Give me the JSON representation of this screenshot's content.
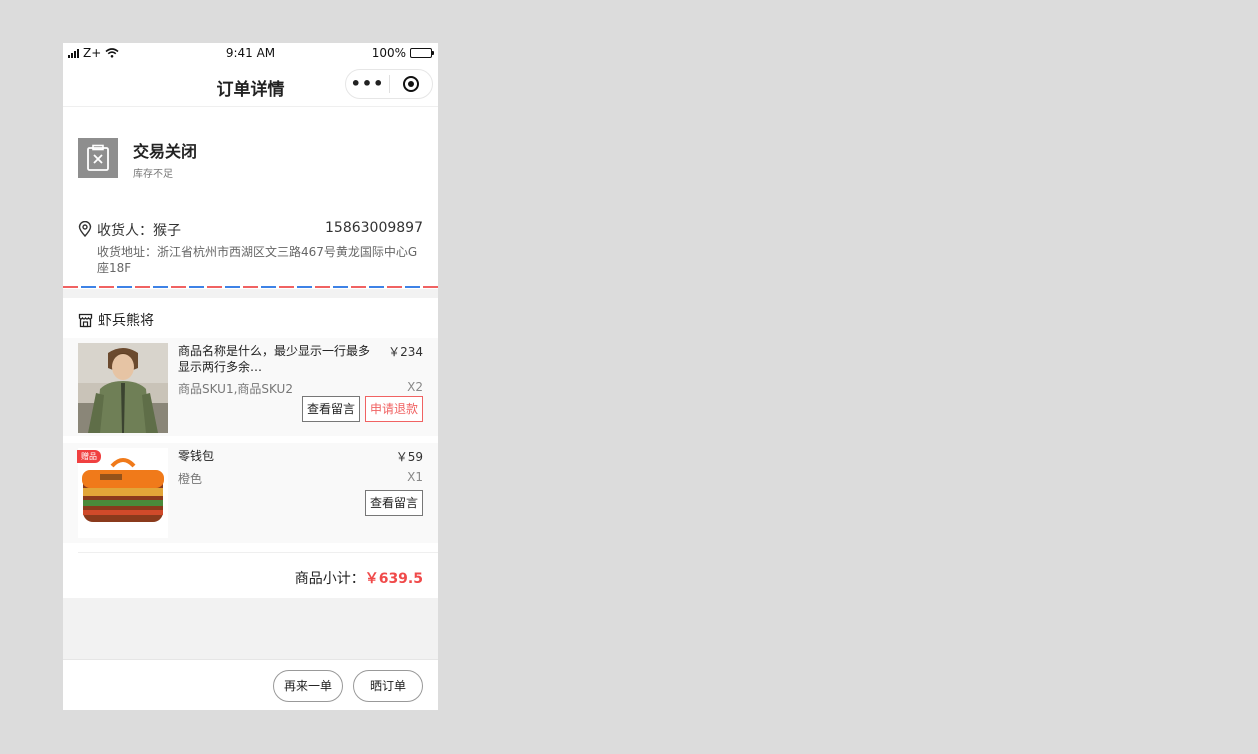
{
  "status_bar": {
    "carrier": "Z+",
    "time": "9:41 AM",
    "battery": "100%"
  },
  "nav": {
    "title": "订单详情",
    "more_label": "•••"
  },
  "order_status": {
    "title": "交易关闭",
    "subtitle": "库存不足"
  },
  "address": {
    "receiver_label": "收货人：猴子",
    "phone": "15863009897",
    "address_text": "收货地址：浙江省杭州市西湖区文三路467号黄龙国际中心G座18F"
  },
  "shop": {
    "name": "虾兵熊将",
    "items": [
      {
        "name": "商品名称是什么，最少显示一行最多显示两行多余…",
        "price": "￥234",
        "sku": "商品SKU1,商品SKU2",
        "qty": "X2",
        "buttons": [
          "查看留言",
          "申请退款"
        ]
      },
      {
        "badge": "赠品",
        "name": "零钱包",
        "price": "￥59",
        "sku": "橙色",
        "qty": "X1",
        "buttons": [
          "查看留言"
        ]
      }
    ],
    "subtotal_label": "商品小计：",
    "subtotal_amount": "￥639.5"
  },
  "bottom_bar": {
    "buttons": [
      "再来一单",
      "晒订单"
    ]
  },
  "colors": {
    "accent_red": "#f04a4a",
    "stripe_blue": "#3d82e6",
    "status_icon_gray": "#8e8e8e"
  }
}
